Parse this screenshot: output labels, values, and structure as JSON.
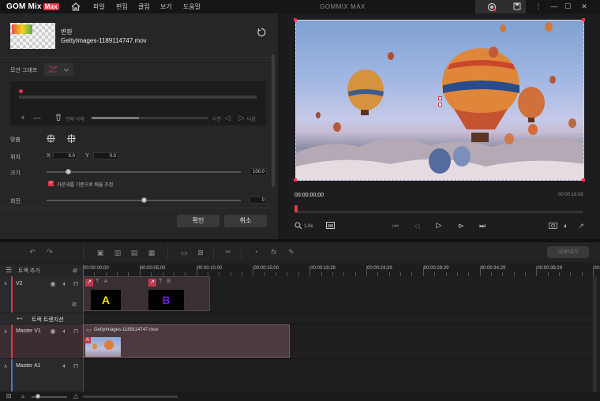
{
  "app": {
    "logo": "GOM Mix",
    "logo_badge": "Max",
    "window_title": "GOMMIX MAX",
    "menu": [
      "파일",
      "편집",
      "클립",
      "보기",
      "도움말"
    ],
    "accent": "#e8344a"
  },
  "left_panel": {
    "section_title": "변환",
    "filename": "GettyImages-1189114747.mov",
    "motion_graph_label": "모션 그래프",
    "delete_all": "전체 삭제",
    "prev": "이전",
    "next": "다음",
    "fit_label": "맞춤",
    "position_label": "위치",
    "x_label": "X",
    "x_value": "0.0",
    "y_label": "Y",
    "y_value": "0.0",
    "size_label": "크기",
    "size_value": "100.0",
    "size_slider": 0.11,
    "scale_checkbox_label": "가운데를 기준으로 배율 조정",
    "rotation_label": "회전",
    "rotation_value": "0",
    "rotation_slider": 0.5,
    "confirm_button": "확인",
    "cancel_button": "취소"
  },
  "preview": {
    "current_time": "00:00:00;00",
    "total_time": "00:00:18;08",
    "zoom": "1.0x"
  },
  "toolbar": {
    "export_button": "내보내기"
  },
  "timeline": {
    "add_track": "트랙 추가",
    "ruler": [
      "00:00:00;00",
      "00:00:05;00",
      "00:00:10;00",
      "00:00:15;00",
      "00:00:19;29",
      "00:00:24;29",
      "00:00:29;29",
      "00:00:34;29",
      "00:00:39;29",
      "00:00:4"
    ],
    "tracks": [
      {
        "name": "V2",
        "clips": [
          {
            "label": "A",
            "type": "T",
            "color": "#f4e400"
          },
          {
            "label": "B",
            "type": "T",
            "color": "#6a1fd6"
          }
        ]
      },
      {
        "name": "트랙 트랜지션"
      },
      {
        "name": "Master V1",
        "clip": "GettyImages-1189114747.mov"
      },
      {
        "name": "Master A1"
      }
    ]
  }
}
